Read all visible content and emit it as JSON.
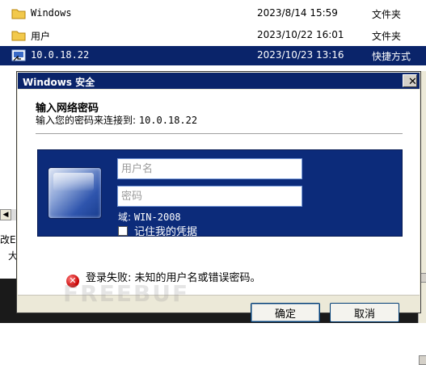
{
  "explorer": {
    "files": [
      {
        "name": "Windows",
        "date": "2023/8/14 15:59",
        "type": "文件夹",
        "icon": "folder-icon"
      },
      {
        "name": "用户",
        "date": "2023/10/22 16:01",
        "type": "文件夹",
        "icon": "folder-icon"
      },
      {
        "name": "10.0.18.22",
        "date": "2023/10/23 13:16",
        "type": "快捷方式",
        "icon": "shortcut-icon",
        "selected": true
      }
    ],
    "left_fragments": [
      "改E",
      "大"
    ]
  },
  "dialog": {
    "title": "Windows 安全",
    "close_glyph": "✕",
    "header_title": "输入网络密码",
    "header_sub_prefix": "输入您的密码来连接到: ",
    "header_sub_host": "10.0.18.22",
    "username_placeholder": "用户名",
    "password_placeholder": "密码",
    "domain_label": "域: ",
    "domain_value": "WIN-2008",
    "remember_label": "记住我的凭据",
    "error_glyph": "✕",
    "error_message": "登录失败: 未知的用户名或错误密码。",
    "ok_label": "确定",
    "cancel_label": "取消"
  },
  "watermark": "FREEBUF",
  "colors": {
    "selection": "#0a246a",
    "titlebar": "#0a246a",
    "credential_panel": "#0c2b7a",
    "error": "#c40000"
  }
}
